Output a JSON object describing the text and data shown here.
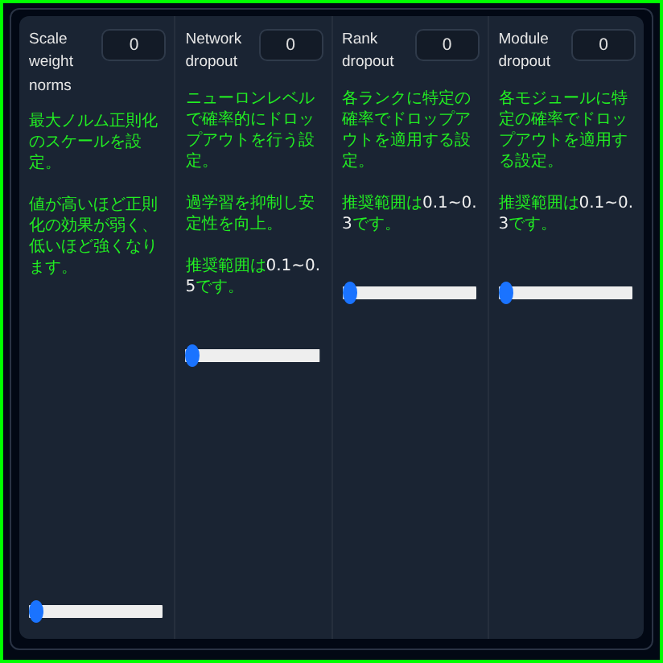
{
  "columns": [
    {
      "label": "Scale weight norms",
      "value": "0",
      "paragraphs": [
        [
          {
            "kind": "plain",
            "text": "最大ノルム正則化のスケールを設定。"
          }
        ],
        [
          {
            "kind": "plain",
            "text": "値が高いほど正則化の効果が弱く、低いほど強くなります。"
          }
        ]
      ],
      "slider": {
        "level": 0
      }
    },
    {
      "label": "Network dropout",
      "value": "0",
      "paragraphs": [
        [
          {
            "kind": "plain",
            "text": "ニューロンレベルで確率的にドロップアウトを行う設定。"
          }
        ],
        [
          {
            "kind": "plain",
            "text": "過学習を抑制し安定性を向上。"
          }
        ],
        [
          {
            "kind": "plain",
            "text": "推奨範囲は"
          },
          {
            "kind": "value",
            "text": "0.1~0.5"
          },
          {
            "kind": "plain",
            "text": "です。"
          }
        ]
      ],
      "slider": {
        "level": 0
      }
    },
    {
      "label": "Rank dropout",
      "value": "0",
      "paragraphs": [
        [
          {
            "kind": "plain",
            "text": "各ランクに特定の確率でドロップアウトを適用する設定。"
          }
        ],
        [
          {
            "kind": "plain",
            "text": "推奨範囲は"
          },
          {
            "kind": "value",
            "text": "0.1~0.3"
          },
          {
            "kind": "plain",
            "text": "です。"
          }
        ]
      ],
      "slider": {
        "level": 0
      }
    },
    {
      "label": "Module dropout",
      "value": "0",
      "paragraphs": [
        [
          {
            "kind": "plain",
            "text": "各モジュールに特定の確率でドロップアウトを適用する設定。"
          }
        ],
        [
          {
            "kind": "plain",
            "text": "推奨範囲は"
          },
          {
            "kind": "value",
            "text": "0.1~0.3"
          },
          {
            "kind": "plain",
            "text": "です。"
          }
        ]
      ],
      "slider": {
        "level": 0
      }
    }
  ]
}
